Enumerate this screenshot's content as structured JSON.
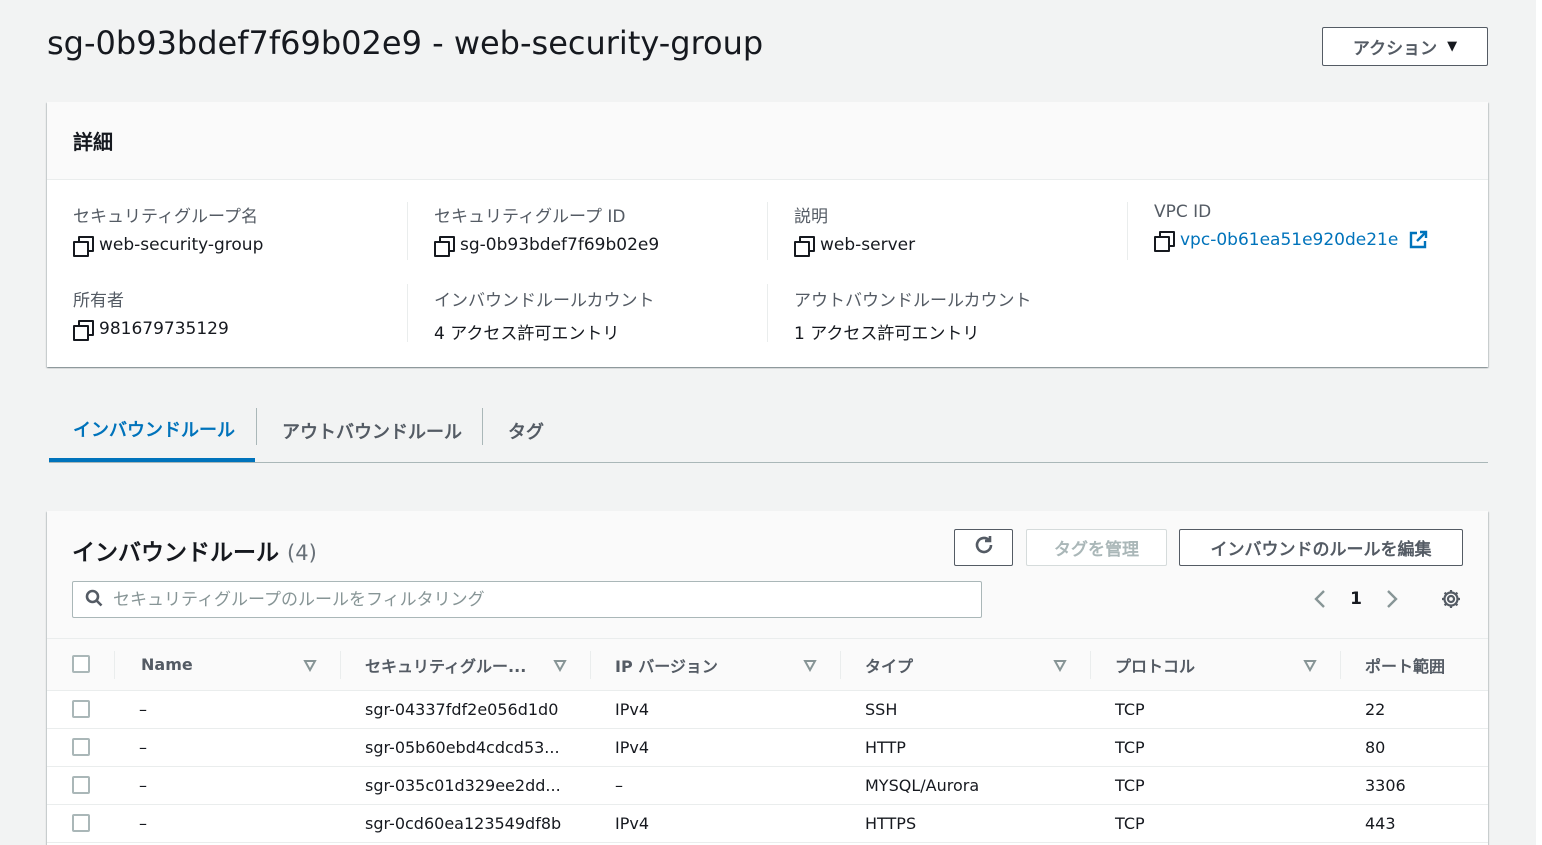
{
  "page": {
    "title": "sg-0b93bdef7f69b02e9 - web-security-group",
    "actions_label": "アクション",
    "actions_caret": "▼"
  },
  "details": {
    "heading": "詳細",
    "fields": {
      "sg_name": {
        "label": "セキュリティグループ名",
        "value": "web-security-group"
      },
      "sg_id": {
        "label": "セキュリティグループ ID",
        "value": "sg-0b93bdef7f69b02e9"
      },
      "description": {
        "label": "説明",
        "value": "web-server"
      },
      "vpc_id": {
        "label": "VPC ID",
        "value": "vpc-0b61ea51e920de21e"
      },
      "owner": {
        "label": "所有者",
        "value": "981679735129"
      },
      "inbound_count": {
        "label": "インバウンドルールカウント",
        "value": "4 アクセス許可エントリ"
      },
      "outbound_count": {
        "label": "アウトバウンドルールカウント",
        "value": "1 アクセス許可エントリ"
      }
    }
  },
  "tabs": [
    {
      "label": "インバウンドルール",
      "active": true
    },
    {
      "label": "アウトバウンドルール",
      "active": false
    },
    {
      "label": "タグ",
      "active": false
    }
  ],
  "rules": {
    "title": "インバウンドルール",
    "count": "(4)",
    "manage_tags_label": "タグを管理",
    "edit_label": "インバウンドのルールを編集",
    "search_placeholder": "セキュリティグループのルールをフィルタリング",
    "page_number": "1",
    "columns": [
      "Name",
      "セキュリティグルー...",
      "IP バージョン",
      "タイプ",
      "プロトコル",
      "ポート範囲"
    ],
    "rows": [
      {
        "name": "–",
        "rule_id": "sgr-04337fdf2e056d1d0",
        "ip_version": "IPv4",
        "type": "SSH",
        "protocol": "TCP",
        "port": "22"
      },
      {
        "name": "–",
        "rule_id": "sgr-05b60ebd4cdcd53...",
        "ip_version": "IPv4",
        "type": "HTTP",
        "protocol": "TCP",
        "port": "80"
      },
      {
        "name": "–",
        "rule_id": "sgr-035c01d329ee2dd...",
        "ip_version": "–",
        "type": "MYSQL/Aurora",
        "protocol": "TCP",
        "port": "3306"
      },
      {
        "name": "–",
        "rule_id": "sgr-0cd60ea123549df8b",
        "ip_version": "IPv4",
        "type": "HTTPS",
        "protocol": "TCP",
        "port": "443"
      }
    ]
  },
  "colors": {
    "link": "#0073bb",
    "text": "#16191f",
    "muted": "#545b64",
    "background": "#f2f3f3"
  },
  "icons": [
    "copy-icon",
    "external-link-icon",
    "refresh-icon",
    "search-icon",
    "chevron-left-icon",
    "chevron-right-icon",
    "gear-icon",
    "sort-icon"
  ]
}
